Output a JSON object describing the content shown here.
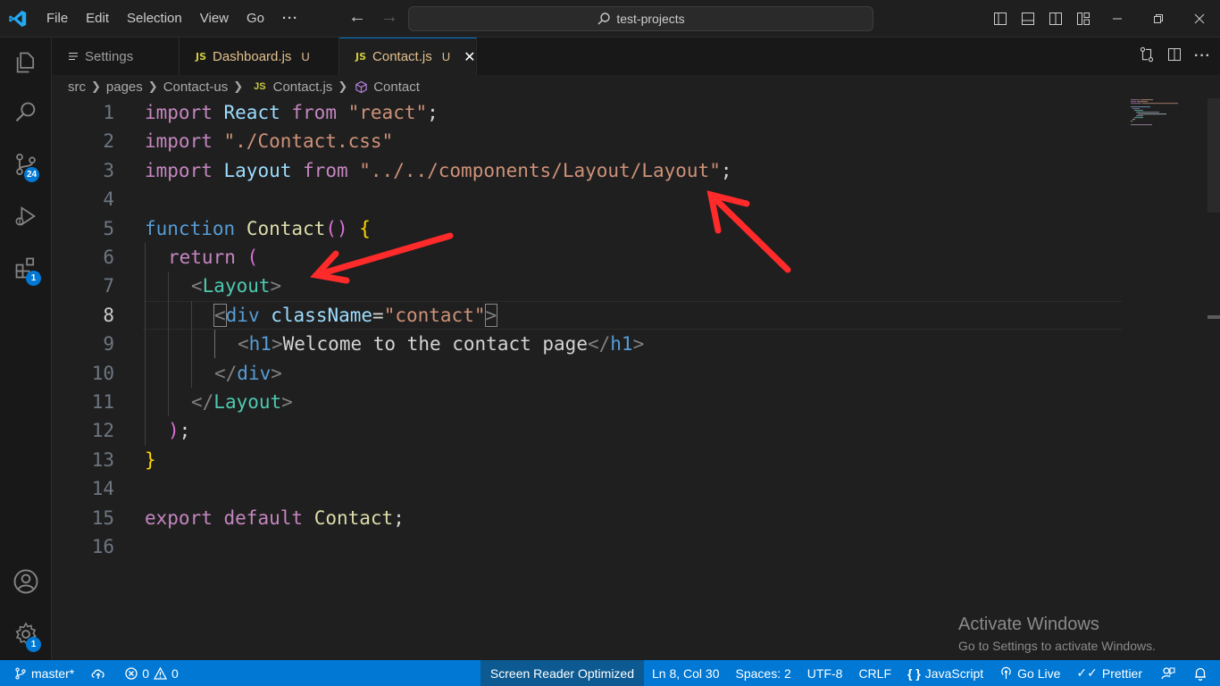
{
  "titlebar": {
    "menu": [
      "File",
      "Edit",
      "Selection",
      "View",
      "Go"
    ],
    "more": "···",
    "search_text": "test-projects",
    "logo_color": "#23a9f2"
  },
  "activity": {
    "scm_badge": "24",
    "extensions_badge": "1",
    "settings_badge": "1"
  },
  "tabs": [
    {
      "label": "Settings",
      "icon": "menu-lines-icon",
      "modified": ""
    },
    {
      "label": "Dashboard.js",
      "icon": "js-icon",
      "modified": "U"
    },
    {
      "label": "Contact.js",
      "icon": "js-icon",
      "modified": "U",
      "active": true
    }
  ],
  "js_badge": "JS",
  "breadcrumb": {
    "segments": [
      "src",
      "pages",
      "Contact-us"
    ],
    "file": "Contact.js",
    "symbol": "Contact"
  },
  "editor": {
    "line_numbers": [
      "1",
      "2",
      "3",
      "4",
      "5",
      "6",
      "7",
      "8",
      "9",
      "10",
      "11",
      "12",
      "13",
      "14",
      "15",
      "16"
    ],
    "current_line": 8,
    "tokens": {
      "l1": [
        "import",
        " ",
        "React",
        " ",
        "from",
        " ",
        "\"react\"",
        ";"
      ],
      "l2": [
        "import",
        " ",
        "\"./Contact.css\""
      ],
      "l3": [
        "import",
        " ",
        "Layout",
        " ",
        "from",
        " ",
        "\"../../components/Layout/Layout\"",
        ";"
      ],
      "l5": [
        "function",
        " ",
        "Contact",
        "(",
        ")",
        " ",
        "{"
      ],
      "l6": [
        "return",
        " ",
        "("
      ],
      "l7": [
        "<",
        "Layout",
        ">"
      ],
      "l8": [
        "<",
        "div",
        " ",
        "className",
        "=",
        "\"contact\"",
        ">"
      ],
      "l9": [
        "<",
        "h1",
        ">",
        "Welcome to the contact page",
        "</",
        "h1",
        ">"
      ],
      "l10": [
        "</",
        "div",
        ">"
      ],
      "l11": [
        "</",
        "Layout",
        ">"
      ],
      "l12": [
        ")",
        ";"
      ],
      "l13": [
        "}"
      ],
      "l15": [
        "export",
        " ",
        "default",
        " ",
        "Contact",
        ";"
      ]
    }
  },
  "watermark": {
    "title": "Activate Windows",
    "subtitle": "Go to Settings to activate Windows."
  },
  "statusbar": {
    "branch": "master*",
    "errors": "0",
    "warnings": "0",
    "screen_reader": "Screen Reader Optimized",
    "position": "Ln 8, Col 30",
    "spaces": "Spaces: 2",
    "encoding": "UTF-8",
    "eol": "CRLF",
    "language": "JavaScript",
    "go_live": "Go Live",
    "prettier": "Prettier"
  },
  "colors": {
    "accent": "#0078d4",
    "annotation_arrow": "#ff2a2a"
  }
}
